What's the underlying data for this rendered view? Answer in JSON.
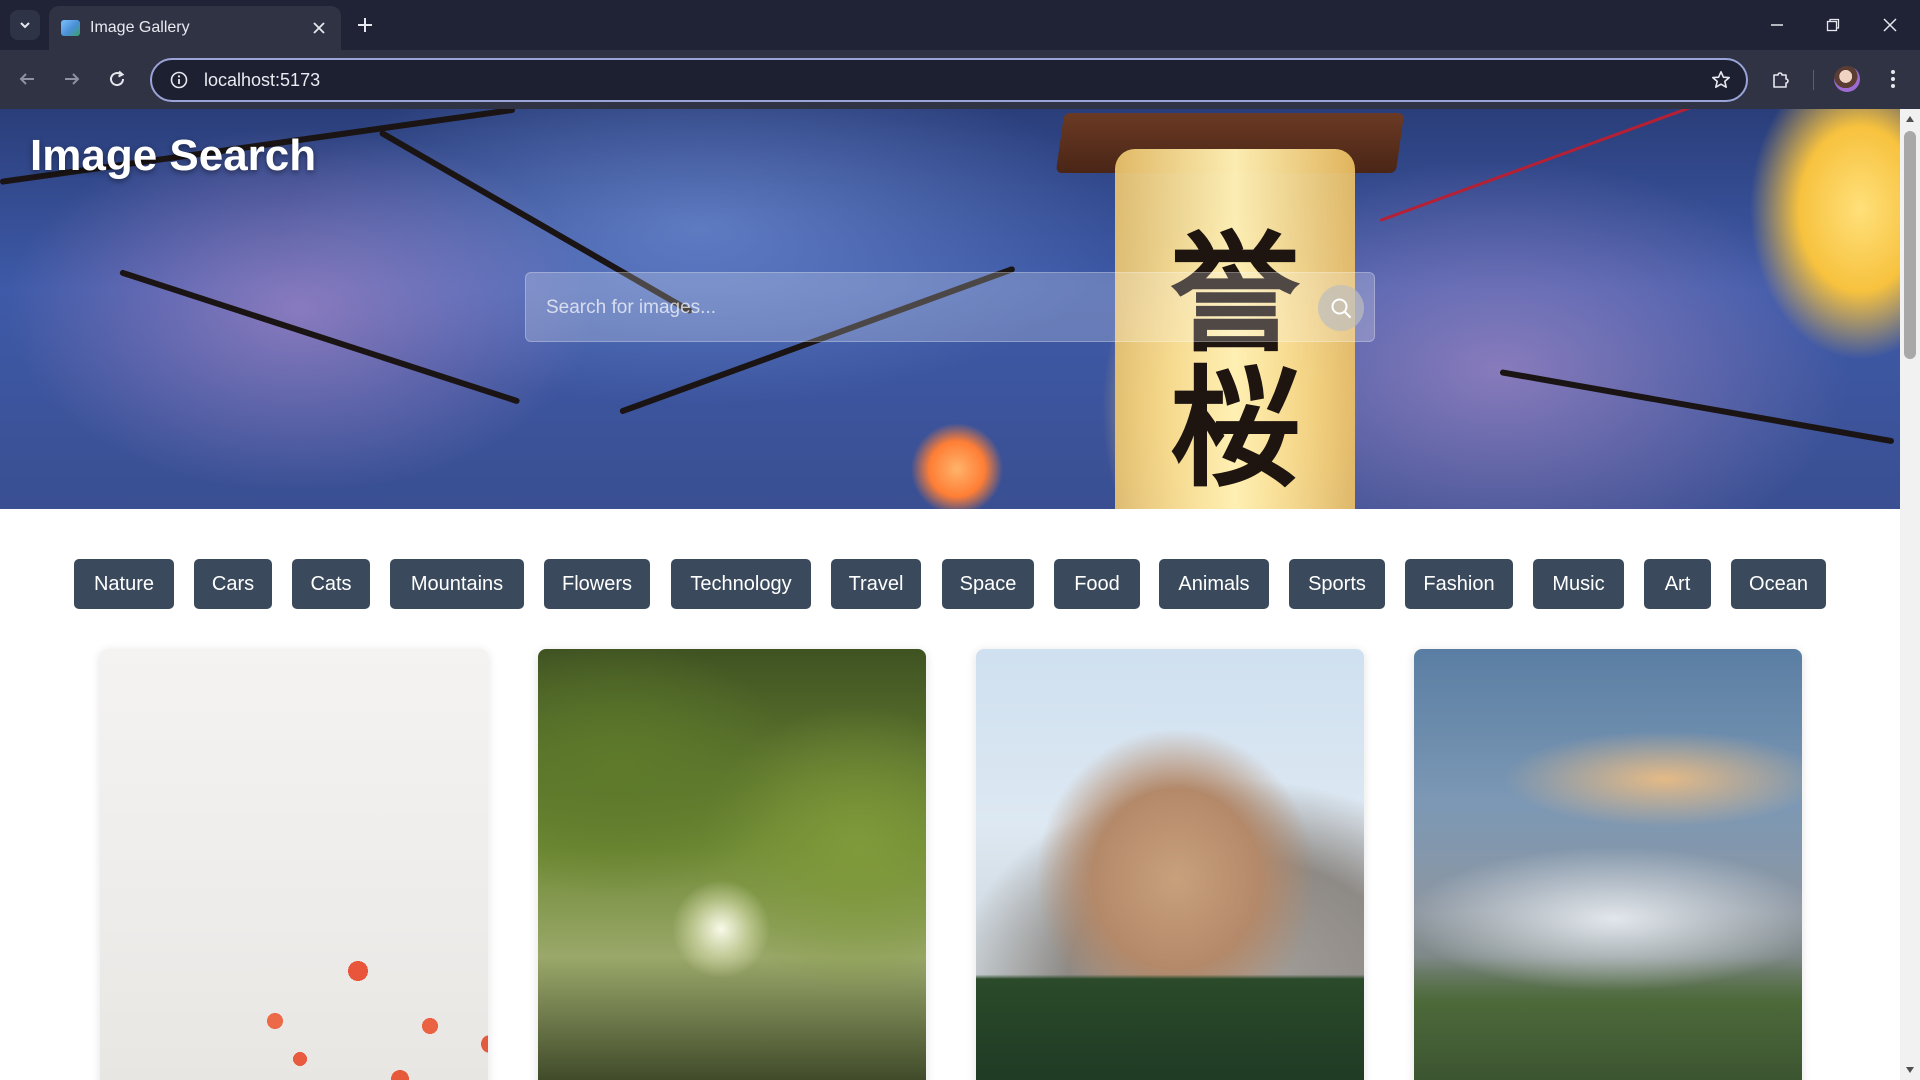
{
  "browser": {
    "tab_title": "Image Gallery",
    "url": "localhost:5173"
  },
  "page": {
    "title": "Image Search",
    "search_placeholder": "Search for images...",
    "search_value": "",
    "categories": [
      "Nature",
      "Cars",
      "Cats",
      "Mountains",
      "Flowers",
      "Technology",
      "Travel",
      "Space",
      "Food",
      "Animals",
      "Sports",
      "Fashion",
      "Music",
      "Art",
      "Ocean"
    ],
    "chip_color": "#3a4a5c",
    "hero_sign_glyphs": [
      "誉",
      "桜"
    ]
  },
  "icons": {
    "tab_list": "chevron-down-icon",
    "tab_favicon": "image-favicon-icon",
    "tab_close": "close-icon",
    "new_tab": "plus-icon",
    "minimize": "minimize-icon",
    "restore": "restore-icon",
    "close_window": "close-icon",
    "back": "arrow-left-icon",
    "forward": "arrow-right-icon",
    "reload": "reload-icon",
    "site_info": "info-icon",
    "bookmark": "star-icon",
    "extensions": "puzzle-icon",
    "menu": "kebab-menu-icon",
    "search": "search-icon"
  }
}
